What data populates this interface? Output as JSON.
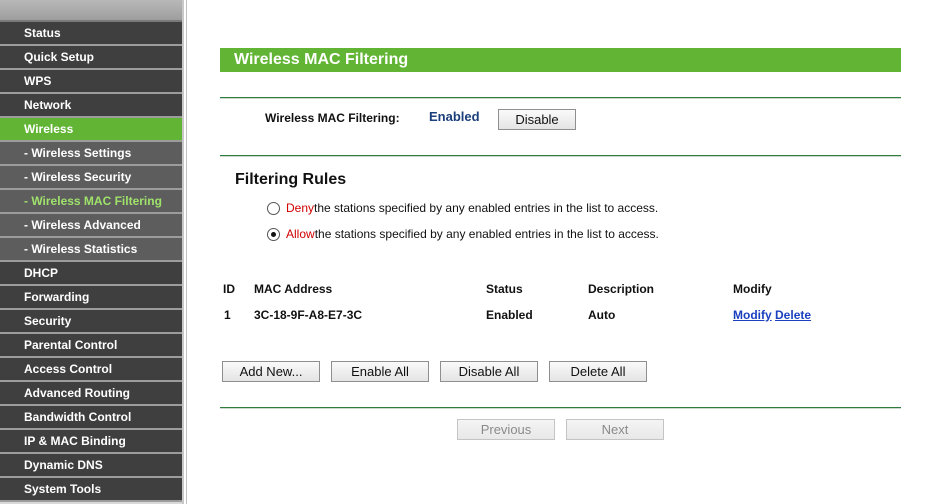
{
  "sidebar": {
    "items": [
      {
        "label": "Status",
        "type": "main"
      },
      {
        "label": "Quick Setup",
        "type": "main"
      },
      {
        "label": "WPS",
        "type": "main"
      },
      {
        "label": "Network",
        "type": "main"
      },
      {
        "label": "Wireless",
        "type": "main",
        "active": true
      },
      {
        "label": "- Wireless Settings",
        "type": "sub"
      },
      {
        "label": "- Wireless Security",
        "type": "sub"
      },
      {
        "label": "- Wireless MAC Filtering",
        "type": "sub",
        "active": true
      },
      {
        "label": "- Wireless Advanced",
        "type": "sub"
      },
      {
        "label": "- Wireless Statistics",
        "type": "sub"
      },
      {
        "label": "DHCP",
        "type": "main"
      },
      {
        "label": "Forwarding",
        "type": "main"
      },
      {
        "label": "Security",
        "type": "main"
      },
      {
        "label": "Parental Control",
        "type": "main"
      },
      {
        "label": "Access Control",
        "type": "main"
      },
      {
        "label": "Advanced Routing",
        "type": "main"
      },
      {
        "label": "Bandwidth Control",
        "type": "main"
      },
      {
        "label": "IP & MAC Binding",
        "type": "main"
      },
      {
        "label": "Dynamic DNS",
        "type": "main"
      },
      {
        "label": "System Tools",
        "type": "main"
      }
    ]
  },
  "page": {
    "title": "Wireless MAC Filtering",
    "filter_label": "Wireless MAC Filtering:",
    "filter_status": "Enabled",
    "disable_button": "Disable",
    "rules_title": "Filtering Rules",
    "deny_keyword": "Deny",
    "deny_text": " the stations specified by any enabled entries in the list to access.",
    "allow_keyword": "Allow",
    "allow_text": " the stations specified by any enabled entries in the list to access.",
    "selected_rule": "allow"
  },
  "table": {
    "headers": {
      "id": "ID",
      "mac": "MAC Address",
      "status": "Status",
      "description": "Description",
      "modify": "Modify"
    },
    "rows": [
      {
        "id": "1",
        "mac": "3C-18-9F-A8-E7-3C",
        "status": "Enabled",
        "description": "Auto",
        "modify": "Modify",
        "delete": "Delete"
      }
    ]
  },
  "buttons": {
    "add_new": "Add New...",
    "enable_all": "Enable All",
    "disable_all": "Disable All",
    "delete_all": "Delete All",
    "previous": "Previous",
    "next": "Next"
  },
  "colors": {
    "accent_green": "#62b534",
    "active_sub_text": "#9fe26b",
    "status_blue": "#1b3f7a",
    "keyword_red": "#d00000",
    "link_blue": "#1a3fbf"
  }
}
